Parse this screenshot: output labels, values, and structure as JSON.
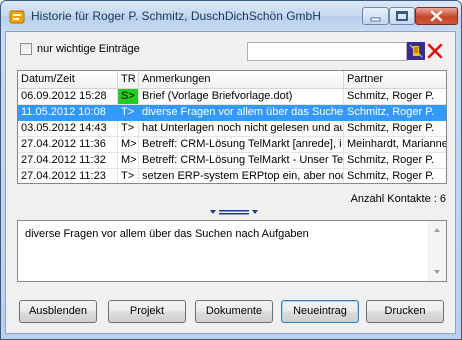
{
  "window": {
    "title": "Historie für Roger P. Schmitz, DuschDichSchön GmbH"
  },
  "filter": {
    "checkbox_label": "nur wichtige Einträge",
    "search_value": ""
  },
  "table": {
    "columns": [
      "Datum/Zeit",
      "TR",
      "Anmerkungen",
      "Partner"
    ],
    "rows": [
      {
        "date": "06.09.2012 15:28",
        "tr": "S>",
        "note": "Brief (Vorlage Briefvorlage.dot)",
        "partner": "Schmitz, Roger P."
      },
      {
        "date": "11.05.2012 10:08",
        "tr": "T>",
        "note": "diverse Fragen vor allem über das Suchen",
        "partner": "Schmitz, Roger P."
      },
      {
        "date": "03.05.2012 14:43",
        "tr": "T>",
        "note": "hat Unterlagen noch nicht gelesen und au",
        "partner": "Schmitz, Roger P."
      },
      {
        "date": "27.04.2012 11:36",
        "tr": "M>",
        "note": "Betreff: CRM-Lösung TelMarkt  [anrede],  i",
        "partner": "Meinhardt, Marianne"
      },
      {
        "date": "27.04.2012 11:32",
        "tr": "M>",
        "note": "Betreff: CRM-Lösung TelMarkt - Unser Tel",
        "partner": "Schmitz, Roger P."
      },
      {
        "date": "27.04.2012 11:23",
        "tr": "T>",
        "note": "setzen ERP-system ERPtop ein, aber noch",
        "partner": "Schmitz, Roger P."
      }
    ]
  },
  "count_text": "Anzahl Kontakte : 6",
  "memo_text": "diverse Fragen vor allem über das Suchen nach Aufgaben",
  "buttons": {
    "hide": "Ausblenden",
    "project": "Projekt",
    "documents": "Dokumente",
    "new_entry": "Neueintrag",
    "print": "Drucken"
  },
  "colors": {
    "selection": "#3399ff",
    "tr_sent": "#22cc22"
  }
}
